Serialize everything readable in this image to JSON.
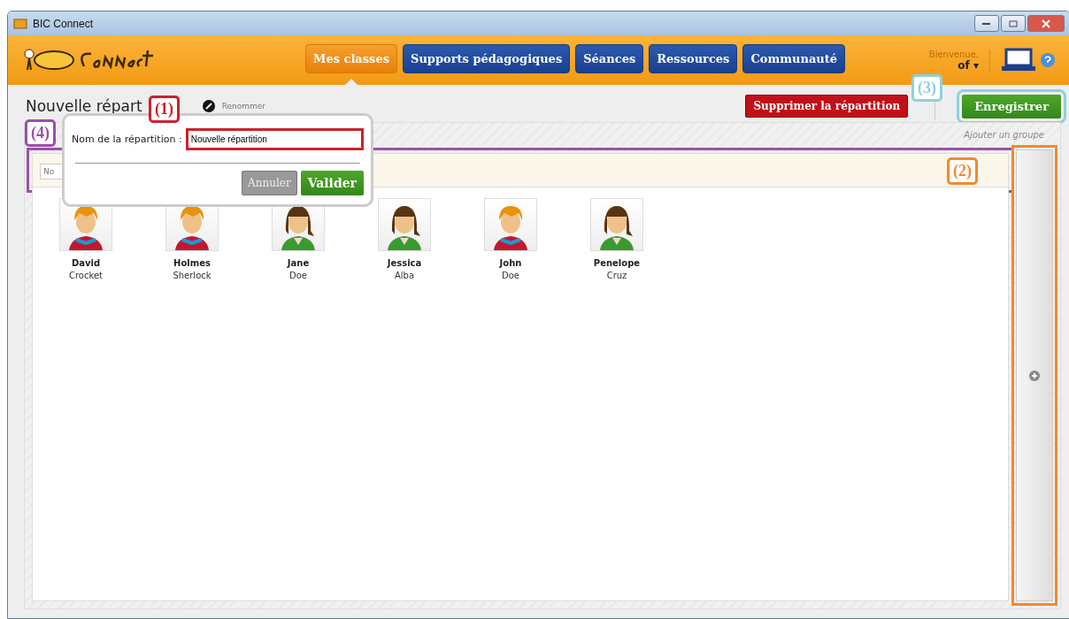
{
  "window": {
    "title": "BIC Connect"
  },
  "nav": [
    {
      "label": "Mes classes",
      "selected": true
    },
    {
      "label": "Supports pédagogiques",
      "selected": false
    },
    {
      "label": "Séances",
      "selected": false
    },
    {
      "label": "Ressources",
      "selected": false
    },
    {
      "label": "Communauté",
      "selected": false
    }
  ],
  "user": {
    "greeting": "Bienvenue,",
    "name": "of",
    "caret": "▾"
  },
  "page": {
    "title": "Nouvelle répart",
    "rename": "Renommer",
    "delete_button": "Supprimer la répartition",
    "save_button": "Enregistrer"
  },
  "groups": {
    "add_label": "Ajouter un groupe",
    "group_field": {
      "placeholder": "No"
    }
  },
  "popup": {
    "label": "Nom de la répartition :",
    "value": "Nouvelle répartition",
    "cancel": "Annuler",
    "confirm": "Valider"
  },
  "students": [
    {
      "first": "David",
      "last": "Crocket",
      "kind": "boy"
    },
    {
      "first": "Holmes",
      "last": "Sherlock",
      "kind": "boy"
    },
    {
      "first": "Jane",
      "last": "Doe",
      "kind": "girl"
    },
    {
      "first": "Jessica",
      "last": "Alba",
      "kind": "girl"
    },
    {
      "first": "John",
      "last": "Doe",
      "kind": "boy"
    },
    {
      "first": "Penelope",
      "last": "Cruz",
      "kind": "girl"
    }
  ],
  "annotations": [
    {
      "label": "(1)",
      "color": "#d0202a"
    },
    {
      "label": "(2)",
      "color": "#f08a30"
    },
    {
      "label": "(3)",
      "color": "#8fd0e0"
    },
    {
      "label": "(4)",
      "color": "#9a50a8"
    }
  ]
}
